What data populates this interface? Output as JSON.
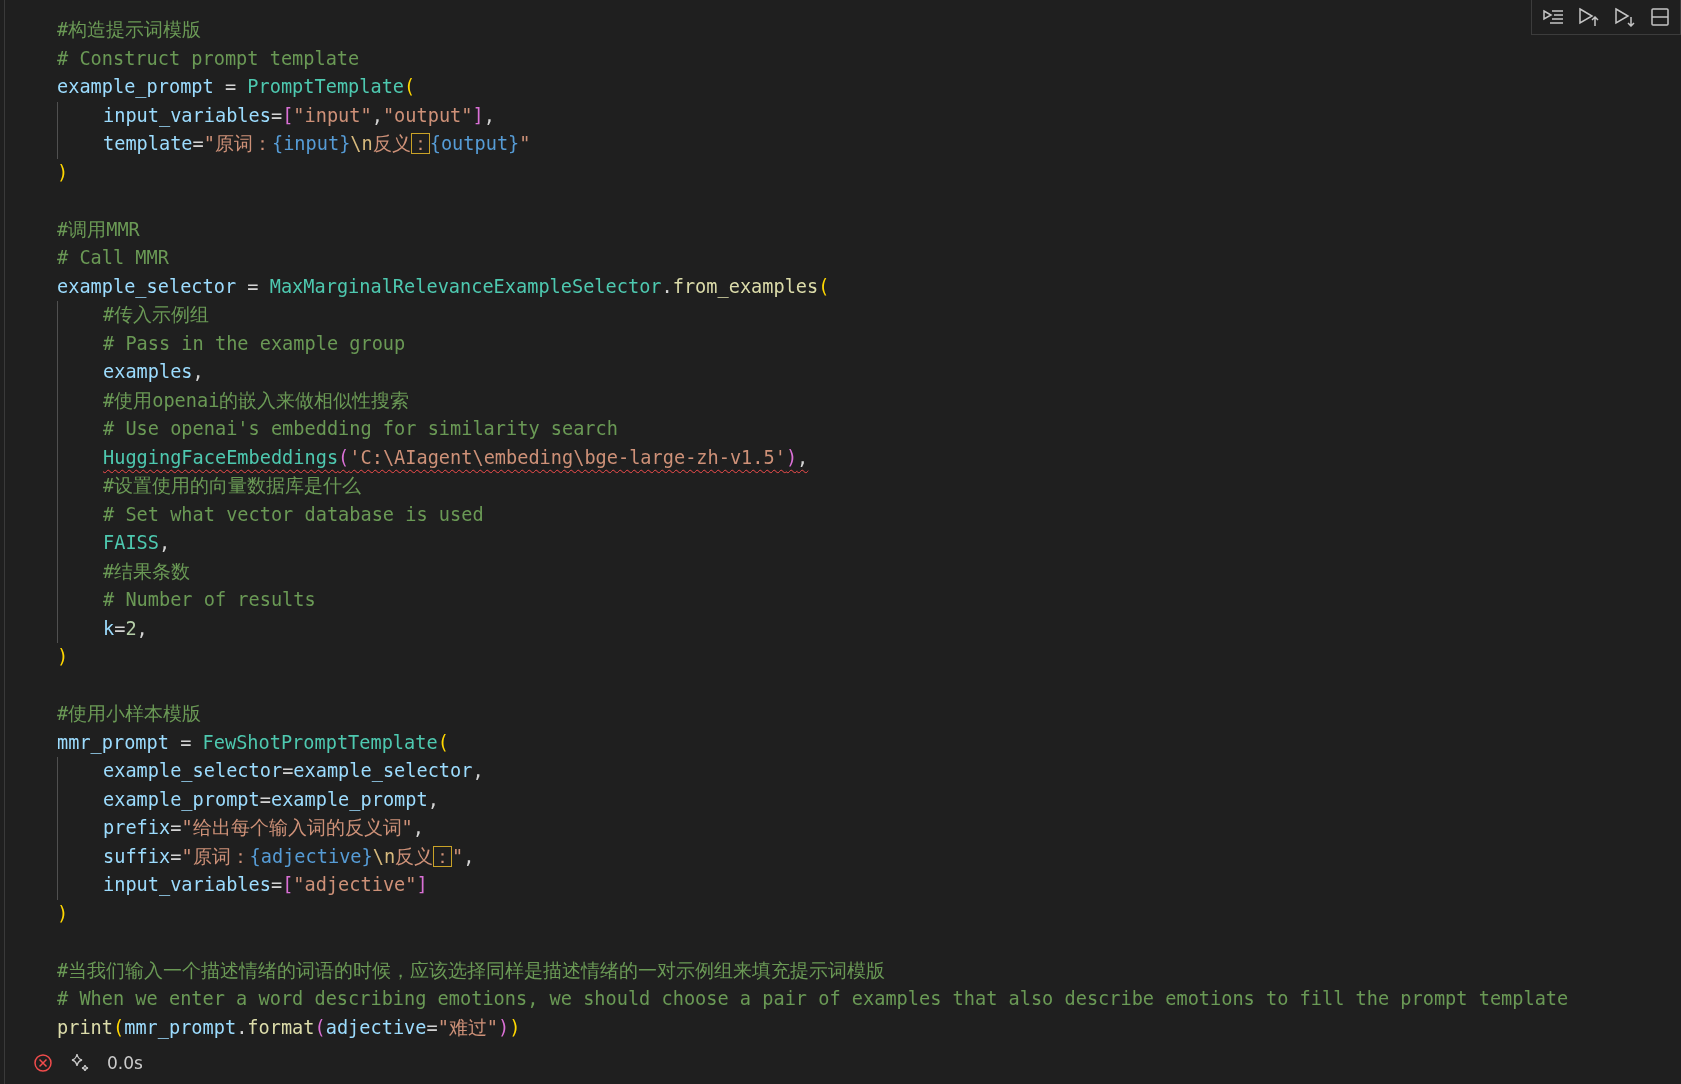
{
  "cell_toolbar": {
    "buttons": [
      {
        "kind": "run-by-line"
      },
      {
        "kind": "run-above"
      },
      {
        "kind": "run-below"
      },
      {
        "kind": "split"
      }
    ]
  },
  "code": [
    {
      "kind": "code",
      "tokens": [
        {
          "kind": "cm",
          "text": "#构造提示词模版"
        }
      ]
    },
    {
      "kind": "code",
      "tokens": [
        {
          "kind": "cm",
          "text": "# Construct prompt template"
        }
      ]
    },
    {
      "kind": "code",
      "tokens": [
        {
          "kind": "var",
          "text": "example_prompt"
        },
        {
          "kind": "op",
          "text": " = "
        },
        {
          "kind": "cls",
          "text": "PromptTemplate"
        },
        {
          "kind": "b1",
          "text": "("
        }
      ],
      "children": [
        {
          "kind": "code",
          "tokens": [
            {
              "kind": "var",
              "text": "input_variables"
            },
            {
              "kind": "op",
              "text": "="
            },
            {
              "kind": "b2",
              "text": "["
            },
            {
              "kind": "str",
              "text": "\"input\""
            },
            {
              "kind": "op",
              "text": ","
            },
            {
              "kind": "str",
              "text": "\"output\""
            },
            {
              "kind": "b2",
              "text": "]"
            },
            {
              "kind": "op",
              "text": ","
            }
          ]
        },
        {
          "kind": "code",
          "tokens": [
            {
              "kind": "var",
              "text": "template"
            },
            {
              "kind": "op",
              "text": "="
            },
            {
              "kind": "str",
              "text": "\"原词："
            },
            {
              "kind": "fmt",
              "text": "{input}"
            },
            {
              "kind": "esc",
              "text": "\\n"
            },
            {
              "kind": "str",
              "text": "反义"
            },
            {
              "kind": "boxed",
              "text": "："
            },
            {
              "kind": "fmt",
              "text": "{output}"
            },
            {
              "kind": "str",
              "text": "\""
            }
          ]
        }
      ]
    },
    {
      "kind": "code",
      "tokens": [
        {
          "kind": "b1",
          "text": ")"
        }
      ]
    },
    {
      "kind": "blank"
    },
    {
      "kind": "code",
      "tokens": [
        {
          "kind": "cm",
          "text": "#调用MMR"
        }
      ]
    },
    {
      "kind": "code",
      "tokens": [
        {
          "kind": "cm",
          "text": "# Call MMR"
        }
      ]
    },
    {
      "kind": "code",
      "tokens": [
        {
          "kind": "var",
          "text": "example_selector"
        },
        {
          "kind": "op",
          "text": " = "
        },
        {
          "kind": "cls",
          "text": "MaxMarginalRelevanceExampleSelector"
        },
        {
          "kind": "op",
          "text": "."
        },
        {
          "kind": "fn",
          "text": "from_examples"
        },
        {
          "kind": "b1",
          "text": "("
        }
      ],
      "children": [
        {
          "kind": "code",
          "tokens": [
            {
              "kind": "cm",
              "text": "#传入示例组"
            }
          ]
        },
        {
          "kind": "code",
          "tokens": [
            {
              "kind": "cm",
              "text": "# Pass in the example group"
            }
          ]
        },
        {
          "kind": "code",
          "tokens": [
            {
              "kind": "var",
              "text": "examples"
            },
            {
              "kind": "op",
              "text": ","
            }
          ]
        },
        {
          "kind": "code",
          "tokens": [
            {
              "kind": "cm",
              "text": "#使用openai的嵌入来做相似性搜索"
            }
          ]
        },
        {
          "kind": "code",
          "tokens": [
            {
              "kind": "cm",
              "text": "# Use openai's embedding for similarity search"
            }
          ]
        },
        {
          "kind": "code",
          "squiggle": true,
          "tokens": [
            {
              "kind": "cls",
              "text": "HuggingFaceEmbeddings"
            },
            {
              "kind": "b2",
              "text": "("
            },
            {
              "kind": "str",
              "text": "'C:\\AIagent\\embeding\\bge-large-zh-v1.5'"
            },
            {
              "kind": "b2",
              "text": ")"
            },
            {
              "kind": "op",
              "text": ","
            }
          ]
        },
        {
          "kind": "code",
          "tokens": [
            {
              "kind": "cm",
              "text": "#设置使用的向量数据库是什么"
            }
          ]
        },
        {
          "kind": "code",
          "tokens": [
            {
              "kind": "cm",
              "text": "# Set what vector database is used"
            }
          ]
        },
        {
          "kind": "code",
          "tokens": [
            {
              "kind": "cls",
              "text": "FAISS"
            },
            {
              "kind": "op",
              "text": ","
            }
          ]
        },
        {
          "kind": "code",
          "tokens": [
            {
              "kind": "cm",
              "text": "#结果条数"
            }
          ]
        },
        {
          "kind": "code",
          "tokens": [
            {
              "kind": "cm",
              "text": "# Number of results"
            }
          ]
        },
        {
          "kind": "code",
          "tokens": [
            {
              "kind": "var",
              "text": "k"
            },
            {
              "kind": "op",
              "text": "="
            },
            {
              "kind": "num",
              "text": "2"
            },
            {
              "kind": "op",
              "text": ","
            }
          ]
        }
      ]
    },
    {
      "kind": "code",
      "tokens": [
        {
          "kind": "b1",
          "text": ")"
        }
      ]
    },
    {
      "kind": "blank"
    },
    {
      "kind": "code",
      "tokens": [
        {
          "kind": "cm",
          "text": "#使用小样本模版"
        }
      ]
    },
    {
      "kind": "code",
      "tokens": [
        {
          "kind": "var",
          "text": "mmr_prompt"
        },
        {
          "kind": "op",
          "text": " = "
        },
        {
          "kind": "cls",
          "text": "FewShotPromptTemplate"
        },
        {
          "kind": "b1",
          "text": "("
        }
      ],
      "children": [
        {
          "kind": "code",
          "tokens": [
            {
              "kind": "var",
              "text": "example_selector"
            },
            {
              "kind": "op",
              "text": "="
            },
            {
              "kind": "var",
              "text": "example_selector"
            },
            {
              "kind": "op",
              "text": ","
            }
          ]
        },
        {
          "kind": "code",
          "tokens": [
            {
              "kind": "var",
              "text": "example_prompt"
            },
            {
              "kind": "op",
              "text": "="
            },
            {
              "kind": "var",
              "text": "example_prompt"
            },
            {
              "kind": "op",
              "text": ","
            }
          ]
        },
        {
          "kind": "code",
          "tokens": [
            {
              "kind": "var",
              "text": "prefix"
            },
            {
              "kind": "op",
              "text": "="
            },
            {
              "kind": "str",
              "text": "\"给出每个输入词的反义词\""
            },
            {
              "kind": "op",
              "text": ","
            }
          ]
        },
        {
          "kind": "code",
          "tokens": [
            {
              "kind": "var",
              "text": "suffix"
            },
            {
              "kind": "op",
              "text": "="
            },
            {
              "kind": "str",
              "text": "\"原词："
            },
            {
              "kind": "fmt",
              "text": "{adjective}"
            },
            {
              "kind": "esc",
              "text": "\\n"
            },
            {
              "kind": "str",
              "text": "反义"
            },
            {
              "kind": "boxed",
              "text": "："
            },
            {
              "kind": "str",
              "text": "\""
            },
            {
              "kind": "op",
              "text": ","
            }
          ]
        },
        {
          "kind": "code",
          "tokens": [
            {
              "kind": "var",
              "text": "input_variables"
            },
            {
              "kind": "op",
              "text": "="
            },
            {
              "kind": "b2",
              "text": "["
            },
            {
              "kind": "str",
              "text": "\"adjective\""
            },
            {
              "kind": "b2",
              "text": "]"
            }
          ]
        }
      ]
    },
    {
      "kind": "code",
      "tokens": [
        {
          "kind": "b1",
          "text": ")"
        }
      ]
    },
    {
      "kind": "blank"
    },
    {
      "kind": "code",
      "tokens": [
        {
          "kind": "cm",
          "text": "#当我们输入一个描述情绪的词语的时候，应该选择同样是描述情绪的一对示例组来填充提示词模版"
        }
      ]
    },
    {
      "kind": "code",
      "tokens": [
        {
          "kind": "cm",
          "text": "# When we enter a word describing emotions, we should choose a pair of examples that also describe emotions to fill the prompt template"
        }
      ]
    },
    {
      "kind": "code",
      "tokens": [
        {
          "kind": "fn",
          "text": "print"
        },
        {
          "kind": "b1",
          "text": "("
        },
        {
          "kind": "var",
          "text": "mmr_prompt"
        },
        {
          "kind": "op",
          "text": "."
        },
        {
          "kind": "fn",
          "text": "format"
        },
        {
          "kind": "b2",
          "text": "("
        },
        {
          "kind": "var",
          "text": "adjective"
        },
        {
          "kind": "op",
          "text": "="
        },
        {
          "kind": "str",
          "text": "\"难过\""
        },
        {
          "kind": "b2",
          "text": ")"
        },
        {
          "kind": "b1",
          "text": ")"
        }
      ]
    }
  ],
  "status": {
    "failed": true,
    "duration": "0.0s"
  }
}
